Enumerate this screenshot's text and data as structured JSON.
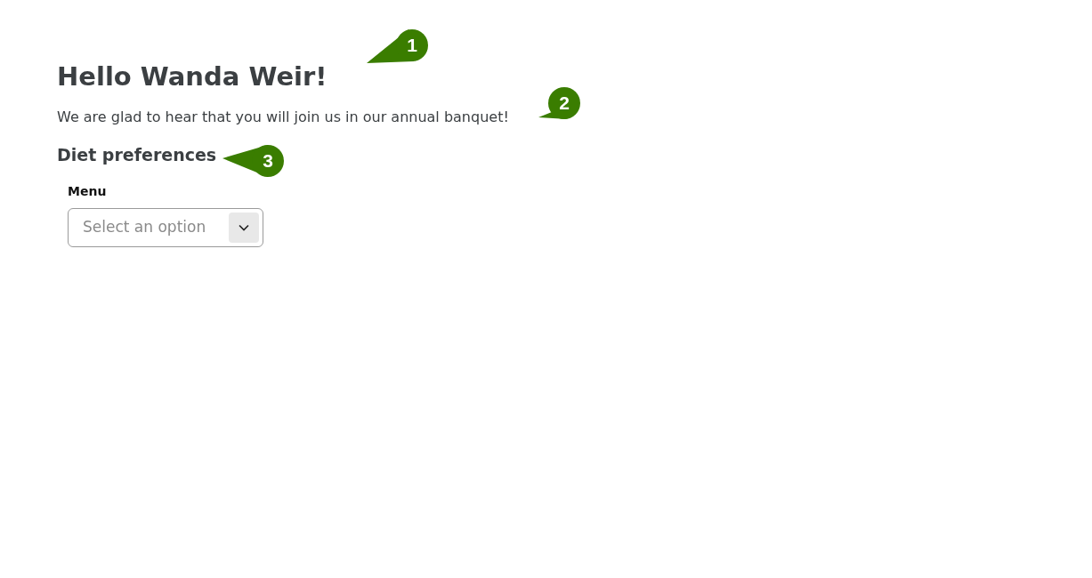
{
  "heading": "Hello Wanda Weir!",
  "intro": "We are glad to hear that you will join us in our annual banquet!",
  "section_title": "Diet preferences",
  "menu_field": {
    "label": "Menu",
    "placeholder": "Select an option"
  },
  "callouts": [
    {
      "label": "1"
    },
    {
      "label": "2"
    },
    {
      "label": "3"
    }
  ]
}
